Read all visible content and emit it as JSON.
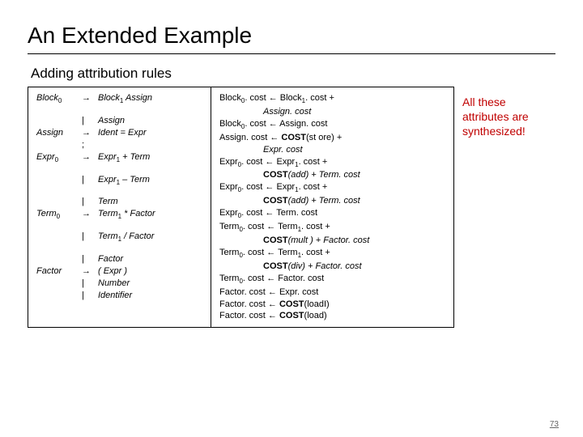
{
  "title": "An Extended Example",
  "subtitle": "Adding attribution rules",
  "callout": "All these attributes are synthesized!",
  "pagenum": "73",
  "left": {
    "r01_lhs": "Block",
    "r01_sub": "0",
    "r01_op": "→",
    "r01_rhs_a": "Block",
    "r01_rhs_asub": "1",
    "r01_rhs_b": " Assign",
    "r02_op": "|",
    "r02_rhs": "Assign",
    "r03_lhs": "Assign",
    "r03_op": "→",
    "r03_rhs": "Ident = Expr",
    "r04_op": ";",
    "r05_lhs": "Expr",
    "r05_sub": "0",
    "r05_op": "→",
    "r05_rhs_a": "Expr",
    "r05_rhs_asub": "1",
    "r05_rhs_b": " + Term",
    "r06_op": "|",
    "r06_rhs_a": "Expr",
    "r06_rhs_asub": "1",
    "r06_rhs_b": " – Term",
    "r07_op": "|",
    "r07_rhs": "Term",
    "r08_lhs": "Term",
    "r08_sub": "0",
    "r08_op": "→",
    "r08_rhs_a": "Term",
    "r08_rhs_asub": "1",
    "r08_rhs_b": " * Factor",
    "r09_op": "|",
    "r09_rhs_a": "Term",
    "r09_rhs_asub": "1",
    "r09_rhs_b": " / Factor",
    "r10_op": "|",
    "r10_rhs": "Factor",
    "r11_lhs": "Factor",
    "r11_op": "→",
    "r11_rhs": "( Expr )",
    "r12_op": "|",
    "r12_rhs": "Number",
    "r13_op": "|",
    "r13_rhs": "Identifier"
  },
  "right": {
    "l01a": "Block",
    "l01as": "0",
    "l01b": ". cost ← Block",
    "l01bs": "1",
    "l01c": ". cost +",
    "l02": "Assign. cost",
    "l03a": "Block",
    "l03as": "0",
    "l03b": ". cost ← Assign. cost",
    "l04a": "Assign. cost ← ",
    "l04b": "COST",
    "l04c": "(st ore) +",
    "l05": "Expr. cost",
    "l06a": "Expr",
    "l06as": "0",
    "l06b": ". cost ← Expr",
    "l06bs": "1",
    "l06c": ". cost +",
    "l07a": "COST",
    "l07b": "(add) + Term. cost",
    "l08a": "Expr",
    "l08as": "0",
    "l08b": ". cost ← Expr",
    "l08bs": "1",
    "l08c": ". cost +",
    "l09a": "COST",
    "l09b": "(add) + Term. cost",
    "l10a": "Expr",
    "l10as": "0",
    "l10b": ". cost ← Term. cost",
    "l11a": "Term",
    "l11as": "0",
    "l11b": ". cost ← Term",
    "l11bs": "1",
    "l11c": ". cost +",
    "l12a": "COST",
    "l12b": "(mult ) + Factor. cost",
    "l13a": "Term",
    "l13as": "0",
    "l13b": ". cost ← Term",
    "l13bs": "1",
    "l13c": ". cost +",
    "l14a": "COST",
    "l14b": "(div) + Factor. cost",
    "l15a": "Term",
    "l15as": "0",
    "l15b": ". cost ← Factor. cost",
    "l16": "Factor. cost ← Expr. cost",
    "l17a": "Factor. cost ← ",
    "l17b": "COST",
    "l17c": "(loadI)",
    "l18a": "Factor. cost ← ",
    "l18b": "COST",
    "l18c": "(load)"
  }
}
